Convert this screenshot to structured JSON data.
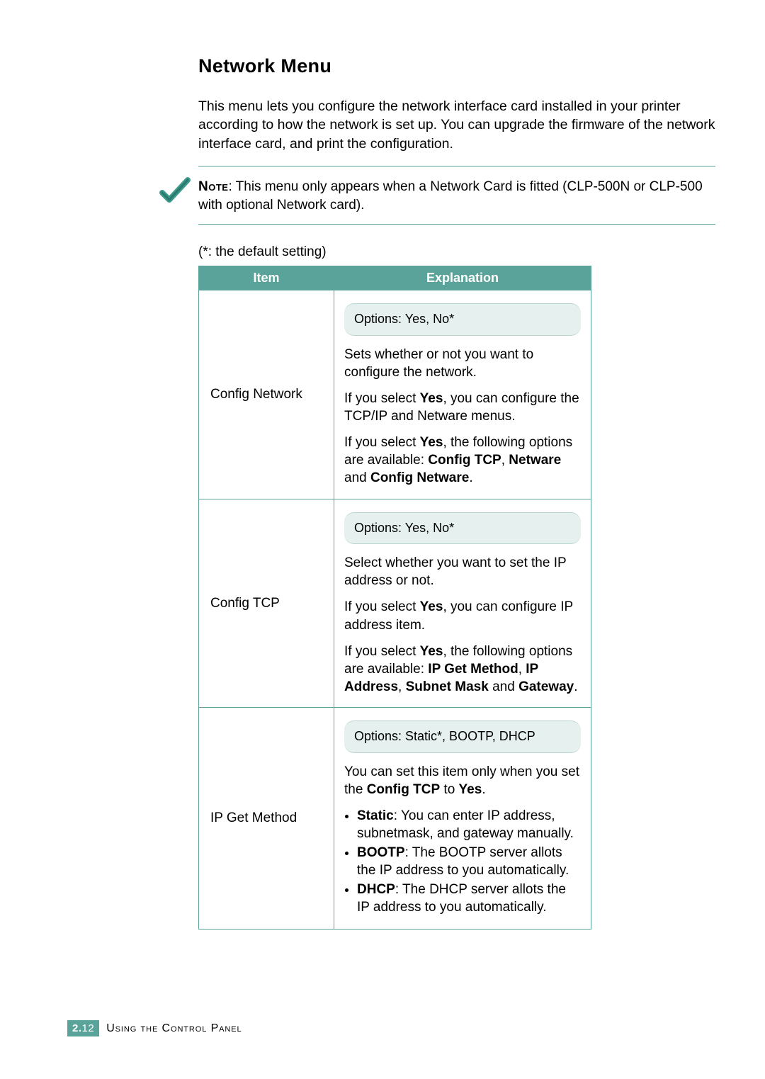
{
  "heading": "Network Menu",
  "intro": "This menu lets you configure the network interface card installed in your printer according to how the network is set up. You can upgrade the firmware of the network interface card, and print the configuration.",
  "note_label": "Note",
  "note_text": ": This menu only appears when a Network Card is fitted (CLP-500N or CLP-500 with optional Network card).",
  "default_marker": "(*: the default setting)",
  "table": {
    "head_item": "Item",
    "head_expl": "Explanation"
  },
  "rows": {
    "config_network": {
      "item": "Config Network",
      "options": "Options: Yes, No*",
      "p1": "Sets whether or not you want to configure the network.",
      "p2_pre": "If you select ",
      "p2_b": "Yes",
      "p2_post": ", you can configure the TCP/IP and Netware menus.",
      "p3_pre": "If you select ",
      "p3_b1": "Yes",
      "p3_mid": ", the following options are available: ",
      "p3_b2": "Config TCP",
      "p3_sep1": ", ",
      "p3_b3": "Netware",
      "p3_and": " and ",
      "p3_b4": "Config Netware",
      "p3_end": "."
    },
    "config_tcp": {
      "item": "Config TCP",
      "options": "Options: Yes, No*",
      "p1": "Select whether you want to set the IP address or not.",
      "p2_pre": "If you select ",
      "p2_b": "Yes",
      "p2_post": ", you can configure IP address item.",
      "p3_pre": "If you select ",
      "p3_b1": "Yes",
      "p3_mid": ", the following options are available: ",
      "p3_b2": "IP Get Method",
      "p3_sep1": ", ",
      "p3_b3": "IP Address",
      "p3_sep2": ", ",
      "p3_b4": "Subnet Mask",
      "p3_and": " and ",
      "p3_b5": "Gateway",
      "p3_end": "."
    },
    "ip_get": {
      "item": "IP Get Method",
      "options": "Options: Static*, BOOTP, DHCP",
      "p1_pre": "You can set this item only when you set the ",
      "p1_b1": "Config TCP",
      "p1_mid": " to ",
      "p1_b2": "Yes",
      "p1_end": ".",
      "li1_b": "Static",
      "li1_t": ": You can enter IP address, subnetmask, and gateway manually.",
      "li2_b": "BOOTP",
      "li2_t": ": The BOOTP server allots the IP address to you automatically.",
      "li3_b": "DHCP",
      "li3_t": ": The DHCP server allots the IP address to you automatically."
    }
  },
  "footer": {
    "chapter_num": "2.",
    "page_num": "12",
    "chapter_title": "Using the Control Panel"
  }
}
